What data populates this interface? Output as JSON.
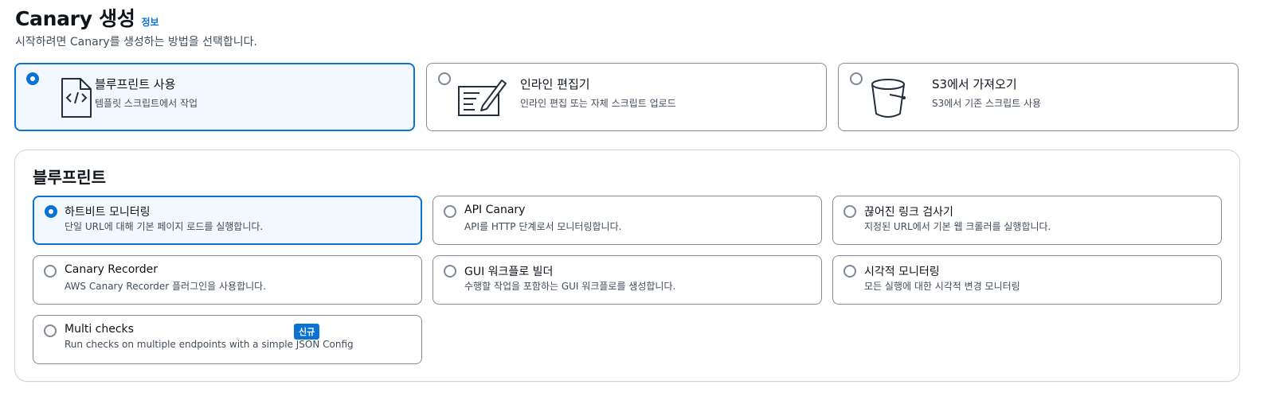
{
  "header": {
    "title": "Canary 생성",
    "info_link": "정보",
    "subtitle": "시작하려면 Canary를 생성하는 방법을 선택합니다."
  },
  "methods": [
    {
      "title": "블루프린트 사용",
      "desc": "템플릿 스크립트에서 작업",
      "icon": "code-document-icon",
      "selected": true
    },
    {
      "title": "인라인 편집기",
      "desc": "인라인 편집 또는 자체 스크립트 업로드",
      "icon": "inline-editor-icon",
      "selected": false
    },
    {
      "title": "S3에서 가져오기",
      "desc": "S3에서 기존 스크립트 사용",
      "icon": "bucket-icon",
      "selected": false
    }
  ],
  "blueprints": {
    "section_title": "블루프린트",
    "items": [
      {
        "title": "하트비트 모니터링",
        "desc": "단일 URL에 대해 기본 페이지 로드를 실행합니다.",
        "selected": true
      },
      {
        "title": "API Canary",
        "desc": "API를 HTTP 단계로서 모니터링합니다.",
        "selected": false
      },
      {
        "title": "끊어진 링크 검사기",
        "desc": "지정된 URL에서 기본 웹 크롤러를 실행합니다.",
        "selected": false
      },
      {
        "title": "Canary Recorder",
        "desc": "AWS Canary Recorder 플러그인을 사용합니다.",
        "selected": false
      },
      {
        "title": "GUI 워크플로 빌더",
        "desc": "수행할 작업을 포함하는 GUI 워크플로를 생성합니다.",
        "selected": false
      },
      {
        "title": "시각적 모니터링",
        "desc": "모든 실행에 대한 시각적 변경 모니터링",
        "selected": false
      },
      {
        "title": "Multi checks",
        "desc": "Run checks on multiple endpoints with a simple JSON Config",
        "badge": "신규",
        "selected": false
      }
    ]
  },
  "colors": {
    "accent": "#0972d3",
    "selected_bg": "#f2f8fd",
    "border": "#8c8c94"
  }
}
